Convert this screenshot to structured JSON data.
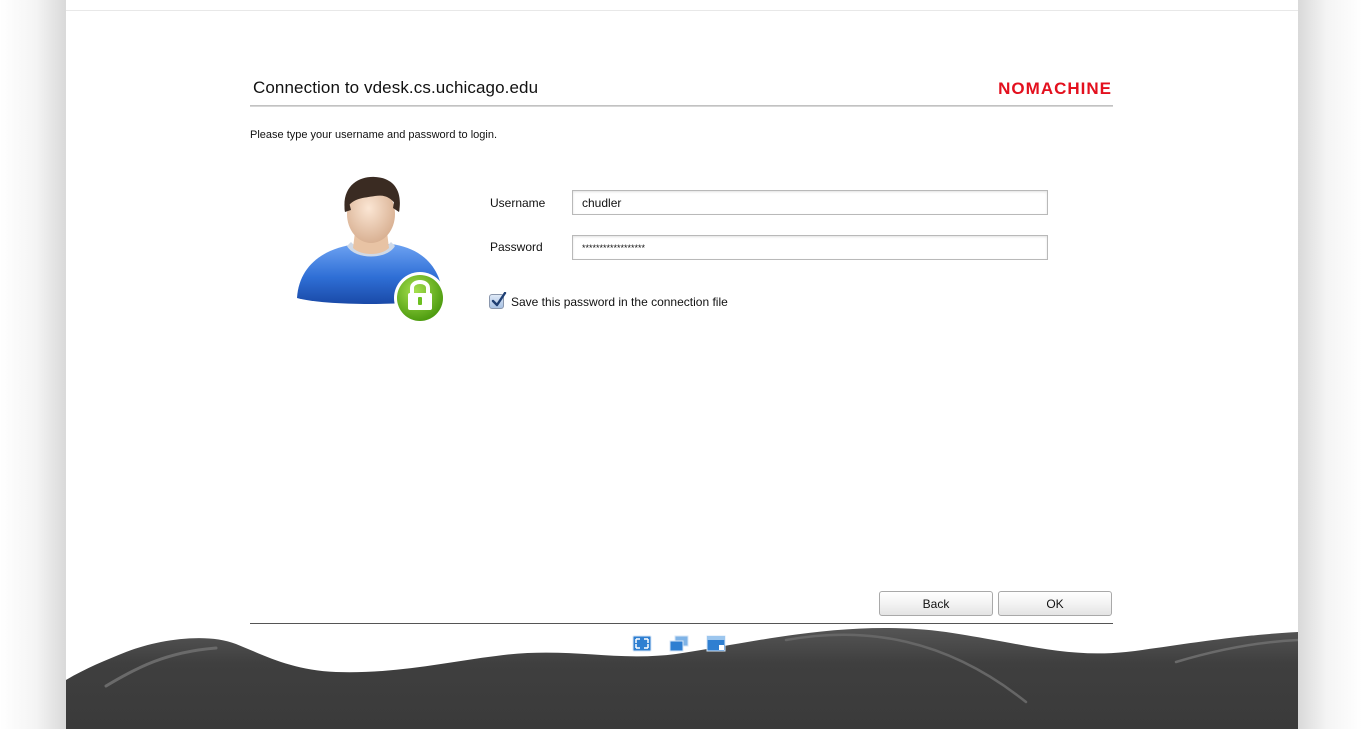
{
  "window": {
    "title": "Connection to vdesk.cs.uchicago.edu",
    "brand": "NOMACHINE"
  },
  "login": {
    "instruction": "Please type your username and password to login.",
    "username_label": "Username",
    "username_value": "chudler",
    "password_label": "Password",
    "password_value": "******************",
    "save_password_label": "Save this password in the connection file",
    "save_password_checked": true
  },
  "buttons": {
    "back_label": "Back",
    "ok_label": "OK"
  },
  "footer": {
    "icons": [
      "fullscreen-view-icon",
      "floating-windows-view-icon",
      "window-view-icon"
    ]
  },
  "colors": {
    "brand_red": "#e3101e",
    "wave_dark": "#3f3f3f",
    "lock_green": "#6cbf1f",
    "shirt_blue": "#2f6fd6"
  }
}
